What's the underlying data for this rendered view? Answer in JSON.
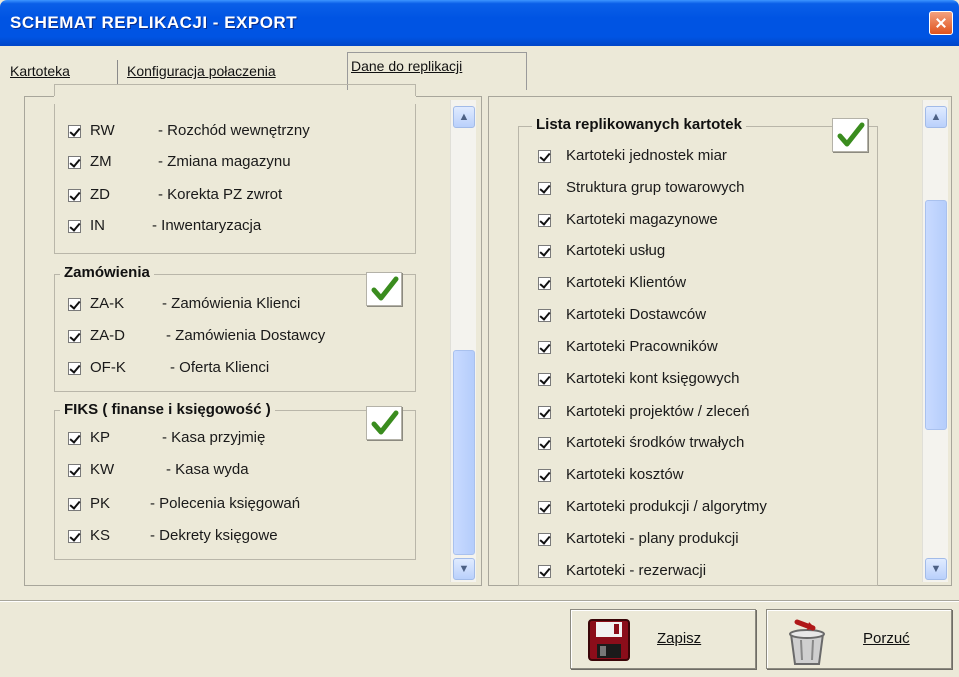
{
  "window": {
    "title": "SCHEMAT REPLIKACJI - EXPORT"
  },
  "tabs": [
    {
      "label": "Kartoteka"
    },
    {
      "label": "Konfiguracja połaczenia"
    },
    {
      "label": "Dane do replikacji"
    }
  ],
  "left": {
    "group_magazyn": {
      "items": [
        {
          "code": "RW",
          "desc": "- Rozchód wewnętrzny"
        },
        {
          "code": "ZM",
          "desc": "- Zmiana magazynu"
        },
        {
          "code": "ZD",
          "desc": "- Korekta PZ zwrot"
        },
        {
          "code": "IN",
          "desc": "- Inwentaryzacja"
        }
      ]
    },
    "group_zamowienia": {
      "title": "Zamówienia",
      "items": [
        {
          "code": "ZA-K",
          "desc": "- Zamówienia Klienci"
        },
        {
          "code": "ZA-D",
          "desc": "- Zamówienia Dostawcy"
        },
        {
          "code": "OF-K",
          "desc": "- Oferta Klienci"
        }
      ]
    },
    "group_fiks": {
      "title": "FIKS ( finanse i księgowość )",
      "items": [
        {
          "code": "KP",
          "desc": "- Kasa przyjmię"
        },
        {
          "code": "KW",
          "desc": "- Kasa wyda"
        },
        {
          "code": "PK",
          "desc": "- Polecenia księgowań"
        },
        {
          "code": "KS",
          "desc": "- Dekrety księgowe"
        }
      ]
    }
  },
  "right": {
    "title": "Lista replikowanych kartotek",
    "items": [
      "Kartoteki jednostek miar",
      "Struktura grup towarowych",
      "Kartoteki magazynowe",
      "Kartoteki usług",
      "Kartoteki Klientów",
      "Kartoteki Dostawców",
      "Kartoteki Pracowników",
      "Kartoteki kont księgowych",
      "Kartoteki projektów / zleceń",
      "Kartoteki środków trwałych",
      "Kartoteki kosztów",
      "Kartoteki produkcji / algorytmy",
      "Kartoteki - plany produkcji",
      "Kartoteki - rezerwacji"
    ]
  },
  "buttons": {
    "save": "Zapisz",
    "discard": "Porzuć"
  },
  "colors": {
    "titlebar": "#0054e3",
    "checkmark": "#3a8c1e",
    "face": "#ece9d8"
  }
}
